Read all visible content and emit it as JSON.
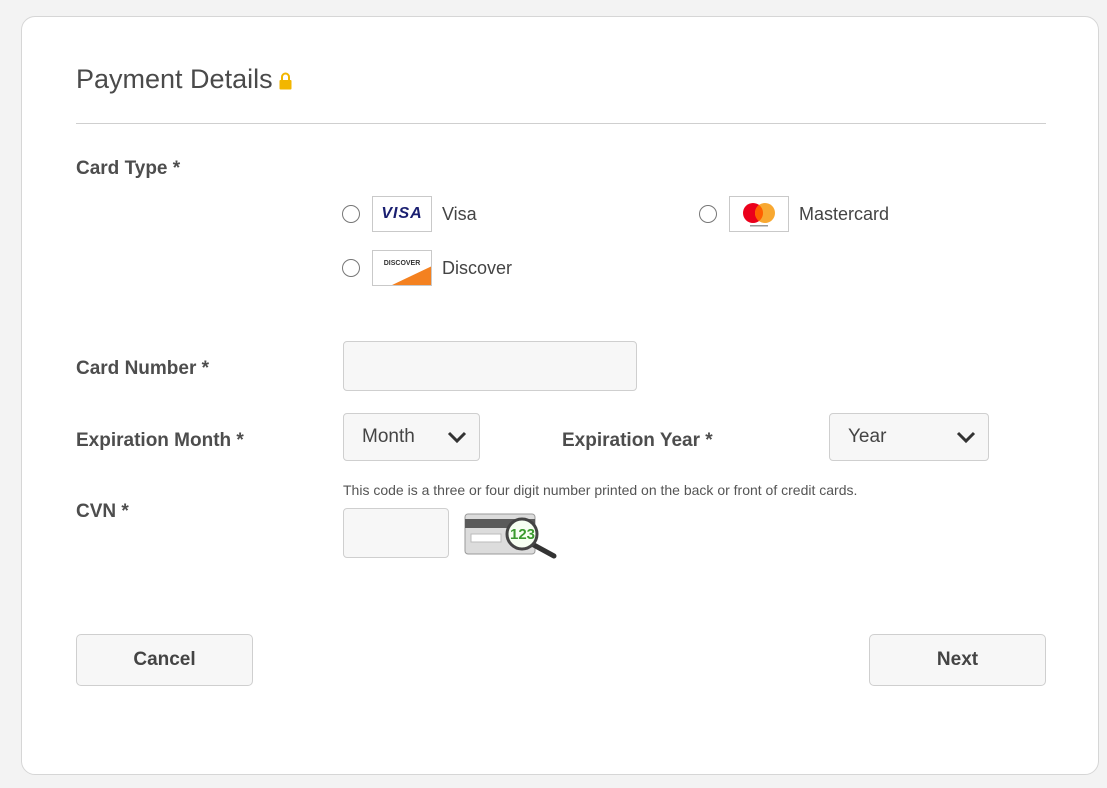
{
  "form": {
    "title": "Payment Details",
    "card_type_label": "Card Type *",
    "card_types": [
      {
        "label": "Visa",
        "logo_text": "VISA"
      },
      {
        "label": "Mastercard"
      },
      {
        "label": "Discover",
        "logo_text": "DISCOVER"
      }
    ],
    "card_number_label": "Card Number *",
    "card_number_value": "",
    "exp_month_label": "Expiration Month *",
    "exp_month_value": "Month",
    "exp_year_label": "Expiration Year *",
    "exp_year_value": "Year",
    "cvn_label": "CVN *",
    "cvn_hint": "This code is a three or four digit number printed on the back or front of credit cards.",
    "cvn_value": "",
    "cvn_image_text": "123",
    "cancel_label": "Cancel",
    "next_label": "Next"
  },
  "colors": {
    "background": "#f3f3f3",
    "card": "#ffffff",
    "lock": "#f2b600",
    "visa_blue": "#1a1f71",
    "mastercard_red": "#eb001b",
    "mastercard_orange": "#f79e1b",
    "discover_orange": "#f48120",
    "cvn_green": "#3a9a2e"
  },
  "icons": [
    "lock-icon",
    "chevron-down-icon",
    "magnifier-icon"
  ]
}
